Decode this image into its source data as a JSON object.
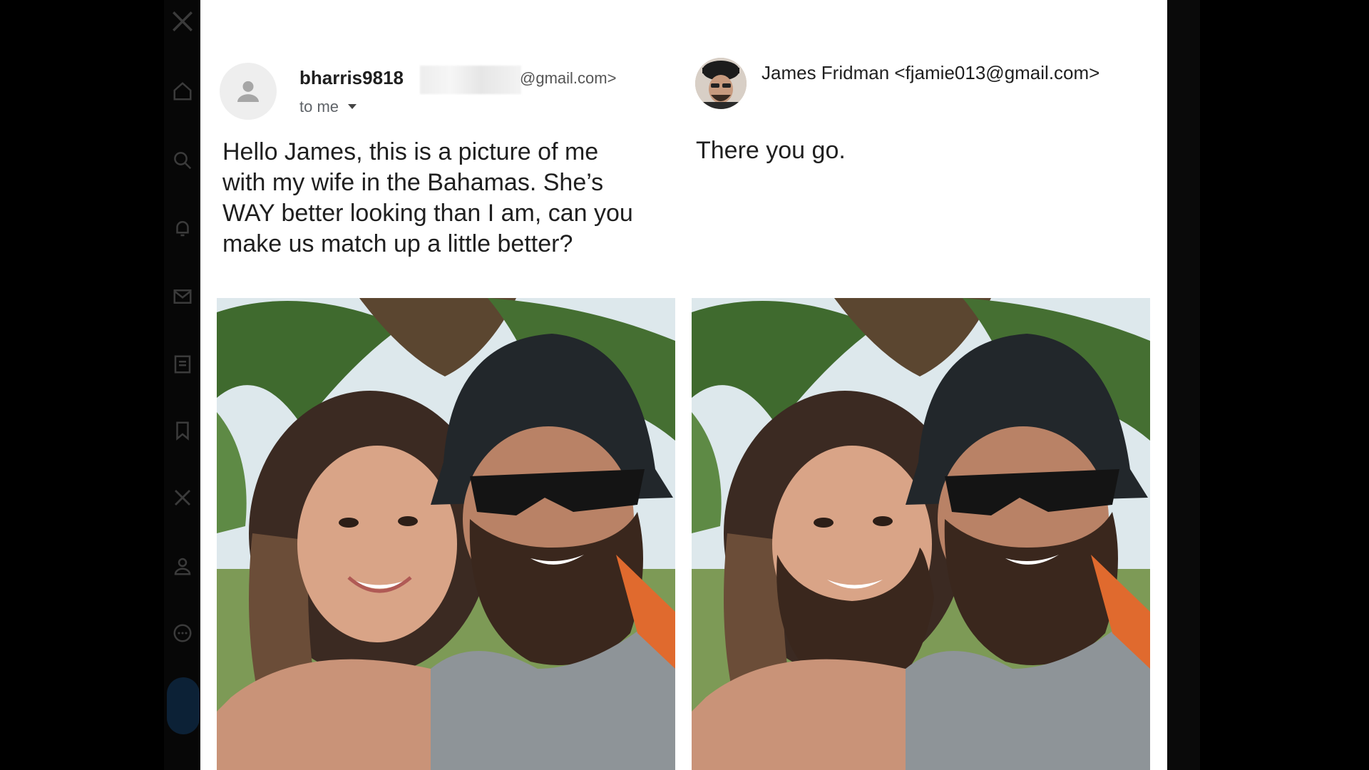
{
  "sender": {
    "name": "bharris9818",
    "email_domain": "@gmail.com>",
    "to_label": "to me"
  },
  "message_left": {
    "lines": [
      "Hello James, this is a picture of me",
      "with my wife in the Bahamas. She’s",
      "WAY better looking than I am, can you",
      "make us match up a little better?"
    ]
  },
  "reply": {
    "sender_line": "James Fridman <fjamie013@gmail.com>",
    "message": "There you go."
  },
  "icons": {
    "sidebar": [
      "x-logo-icon",
      "home-icon",
      "search-icon",
      "bell-icon",
      "mail-icon",
      "list-icon",
      "bookmark-icon",
      "x-icon",
      "profile-icon",
      "more-icon"
    ],
    "avatar_placeholder": "person-icon",
    "to_dropdown": "caret-down-icon"
  },
  "colors": {
    "card_background": "#ffffff",
    "page_background": "#000000",
    "text_primary": "#1f1f1f",
    "text_secondary": "#5f6368"
  }
}
